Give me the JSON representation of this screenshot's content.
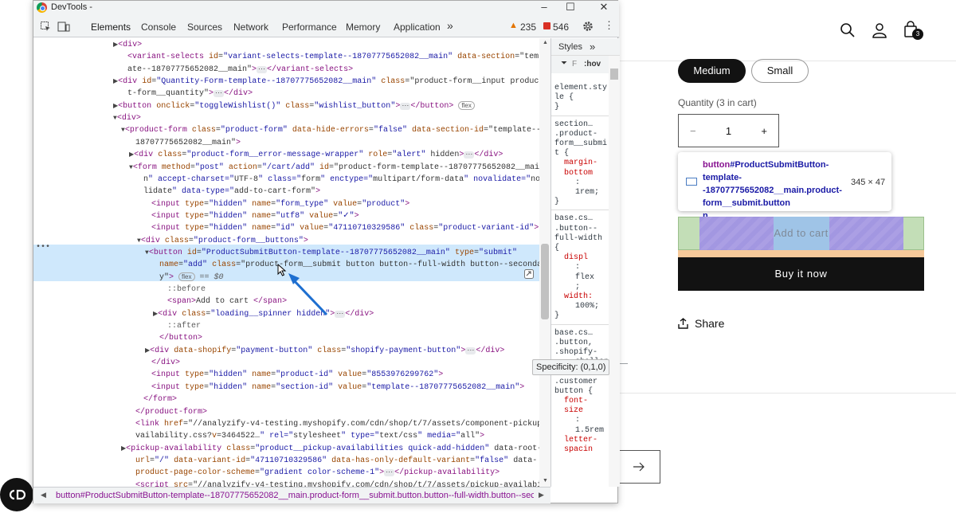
{
  "store": {
    "cart_count": "3",
    "variants": {
      "selected": "Medium",
      "other": "Small"
    },
    "quantity_label": "Quantity (3 in cart)",
    "quantity_minus": "−",
    "quantity_value": "1",
    "quantity_plus": "+",
    "add_to_cart": "Add to cart",
    "buy_now": "Buy it now",
    "share": "Share"
  },
  "inspector_tooltip": {
    "tag": "button",
    "selector": "#ProductSubmitButton-template--18707775652082__main.product-form__submit.button",
    "trailing": "n...",
    "size": "345 × 47"
  },
  "devtools": {
    "title": "DevTools -",
    "tabs": [
      "Elements",
      "Console",
      "Sources",
      "Network",
      "Performance",
      "Memory",
      "Application"
    ],
    "more_tabs": "»",
    "errors": "235",
    "warnings": "546",
    "styles_tab": "Styles",
    "filter_placeholder": ":hov",
    "breadcrumb": "button#ProductSubmitButton-template--18707775652082__main.product-form__submit.button.button--full-width.button--sec",
    "specificity": "Specificity: (0,1,0)",
    "selected_eq": "== $0",
    "dots": "•••",
    "styles": [
      {
        "sel": "element.style",
        "lines": [
          "element.sty",
          "le {",
          "}"
        ]
      },
      {
        "sel": "section",
        "lines": [
          "section…",
          ".product-",
          "form__submi",
          "t {",
          "margin-",
          "bottom",
          ":",
          "1rem;",
          "}"
        ]
      },
      {
        "sel": "base",
        "lines": [
          "base.cs…",
          ".button--",
          "full-width",
          "{",
          "displ",
          ":",
          "flex",
          ";",
          "width:",
          "100%;",
          "}"
        ]
      },
      {
        "sel": "base2",
        "lines": [
          "base.cs…",
          ".button,",
          ".shopify-",
          "challenge__",
          "button,",
          ".customer",
          "button {",
          "font-",
          "size",
          ":",
          "1.5rem",
          "letter-",
          "spacin"
        ]
      }
    ]
  },
  "code": [
    {
      "d": 0,
      "t": "▶",
      "h": "<div>",
      "e": true,
      "c": "</div>"
    },
    {
      "d": 0,
      "t": "",
      "h": "<variant-selects id=\"variant-selects-template--18707775652082__main\" data-section=\"templ"
    },
    {
      "d": 0,
      "t": "",
      "h": "ate--18707775652082__main\"> </variant-selects>"
    },
    {
      "d": 0,
      "t": "▶",
      "h": "<div id=\"Quantity-Form-template--18707775652082__main\" class=\"product-form__input product"
    },
    {
      "d": 0,
      "t": "",
      "h": "t-form__quantity\"> </div>"
    },
    {
      "d": 0,
      "t": "▶",
      "h": "<button onclick=\"toggleWishlist()\" class=\"wishlist_button\"> </button>"
    },
    {
      "d": 0,
      "t": "▼",
      "h": "<div>"
    },
    {
      "d": 1,
      "t": "▼",
      "h": "<product-form class=\"product-form\" data-hide-errors=\"false\" data-section-id=\"template--"
    },
    {
      "d": 1,
      "t": "",
      "h": "18707775652082__main\">"
    },
    {
      "d": 2,
      "t": "▶",
      "h": "<div class=\"product-form__error-message-wrapper\" role=\"alert\" hidden> </div>"
    },
    {
      "d": 2,
      "t": "▼",
      "h": "<form method=\"post\" action=\"/cart/add\" id=\"product-form-template--18707775652082__mai"
    },
    {
      "d": 2,
      "t": "",
      "h": "n\" accept-charset=\"UTF-8\" class=\"form\" enctype=\"multipart/form-data\" novalidate=\"nova"
    },
    {
      "d": 2,
      "t": "",
      "h": "lidate\" data-type=\"add-to-cart-form\">"
    },
    {
      "d": 3,
      "t": "",
      "h": "<input type=\"hidden\" name=\"form_type\" value=\"product\">"
    },
    {
      "d": 3,
      "t": "",
      "h": "<input type=\"hidden\" name=\"utf8\" value=\"✓\">"
    },
    {
      "d": 3,
      "t": "",
      "h": "<input type=\"hidden\" name=\"id\" value=\"47110710329586\" class=\"product-variant-id\">"
    },
    {
      "d": 3,
      "t": "▼",
      "h": "<div class=\"product-form__buttons\">"
    },
    {
      "d": 4,
      "t": "▼",
      "h": "<button id=\"ProductSubmitButton-template--18707775652082__main\" type=\"submit\""
    },
    {
      "d": 4,
      "t": "",
      "h": "name=\"add\" class=\"product-form__submit button button--full-width button--secondar"
    },
    {
      "d": 4,
      "t": "",
      "h": "y\">"
    },
    {
      "d": 5,
      "t": "",
      "h": "::before"
    },
    {
      "d": 5,
      "t": "",
      "h": "<span>Add to cart </span>"
    },
    {
      "d": 5,
      "t": "▶",
      "h": "<div class=\"loading__spinner hidden\"> </div>"
    },
    {
      "d": 5,
      "t": "",
      "h": "::after"
    },
    {
      "d": 4,
      "t": "",
      "h": "</button>"
    },
    {
      "d": 4,
      "t": "▶",
      "h": "<div data-shopify=\"payment-button\" class=\"shopify-payment-button\"> </div>"
    },
    {
      "d": 3,
      "t": "",
      "h": "</div>"
    },
    {
      "d": 3,
      "t": "",
      "h": "<input type=\"hidden\" name=\"product-id\" value=\"8553976299762\">"
    },
    {
      "d": 3,
      "t": "",
      "h": "<input type=\"hidden\" name=\"section-id\" value=\"template--18707775652082__main\">"
    },
    {
      "d": 2,
      "t": "",
      "h": "</form>"
    },
    {
      "d": 1,
      "t": "",
      "h": "</product-form>"
    },
    {
      "d": 1,
      "t": "",
      "h": "<link href=\"//analyzify-v4-testing.myshopify.com/cdn/shop/t/7/assets/component-pickup-a"
    },
    {
      "d": 1,
      "t": "",
      "h": "vailability.css?v=3464522…\" rel=\"stylesheet\" type=\"text/css\" media=\"all\">"
    },
    {
      "d": 1,
      "t": "▶",
      "h": "<pickup-availability class=\"product__pickup-availabilities quick-add-hidden\" data-root-"
    },
    {
      "d": 1,
      "t": "",
      "h": "url=\"/\" data-variant-id=\"47110710329586\" data-has-only-default-variant=\"false\" data-"
    },
    {
      "d": 1,
      "t": "",
      "h": "product-page-color-scheme=\"gradient color-scheme-1\"> </pickup-availability>"
    },
    {
      "d": 1,
      "t": "",
      "h": "<script src=\"//analyzify-v4-testing.myshopify.com/cdn/shop/t/7/assets/pickup-availabili"
    }
  ]
}
